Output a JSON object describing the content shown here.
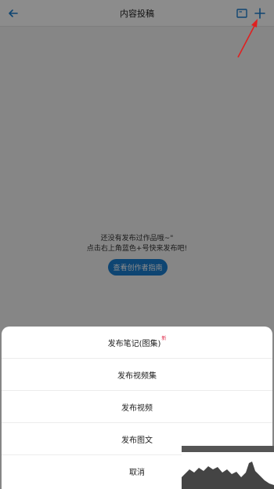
{
  "header": {
    "title": "内容投稿",
    "back_icon": "arrow-left-icon",
    "book_icon": "book-icon",
    "add_icon": "plus-icon"
  },
  "empty_state": {
    "line1": "还没有发布过作品哦~\"",
    "line2": "点击右上角蓝色+号快来发布吧!",
    "guide_button": "查看创作者指南"
  },
  "action_sheet": {
    "items": [
      {
        "label": "发布笔记(图集)",
        "badge": "新"
      },
      {
        "label": "发布视频集"
      },
      {
        "label": "发布视频"
      },
      {
        "label": "发布图文"
      },
      {
        "label": "取消"
      }
    ]
  },
  "colors": {
    "accent": "#1a7fd0",
    "annotation_arrow": "#e02020",
    "badge": "#e02a4a"
  }
}
